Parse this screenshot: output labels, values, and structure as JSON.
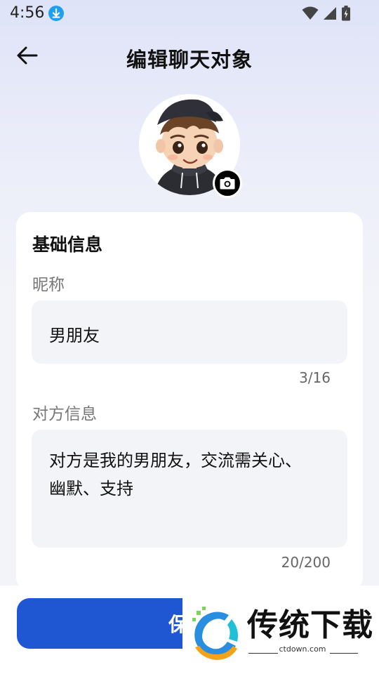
{
  "status_bar": {
    "time": "4:56"
  },
  "header": {
    "title": "编辑聊天对象"
  },
  "form": {
    "section_title": "基础信息",
    "nickname": {
      "label": "昵称",
      "value": "男朋友",
      "counter": "3/16"
    },
    "info": {
      "label": "对方信息",
      "value": "对方是我的男朋友，交流需关心、幽默、支持",
      "counter": "20/200"
    }
  },
  "footer": {
    "save_label": "保存"
  },
  "watermark": {
    "brand": "传统下载",
    "url": "ctdown.com"
  },
  "colors": {
    "primary": "#1f56d2",
    "download_badge": "#1ea0f2"
  }
}
